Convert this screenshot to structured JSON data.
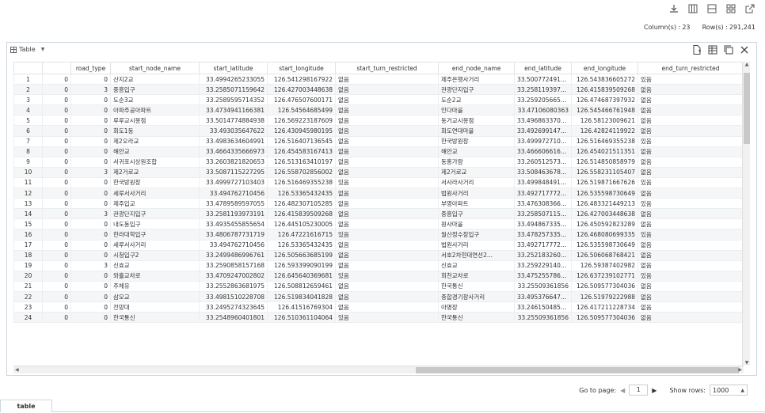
{
  "toolbar": {
    "icons": [
      "download-icon",
      "columns-view-icon",
      "rows-view-icon",
      "grid-view-icon",
      "open-external-icon"
    ]
  },
  "counts": {
    "columns_label": "Column(s) :",
    "columns_value": "23",
    "rows_label": "Row(s) :",
    "rows_value": "291,241"
  },
  "panel": {
    "view_label": "Table",
    "tool_icons": [
      "add-file-icon",
      "table-settings-icon",
      "copy-icon",
      "close-icon"
    ]
  },
  "columns": [
    "",
    "road_type",
    "start_node_name",
    "start_latitude",
    "start_longitude",
    "start_turn_restricted",
    "end_node_name",
    "end_latitude",
    "end_longitude",
    "end_turn_restricted"
  ],
  "rows": [
    [
      "1",
      "0",
      "0",
      "산지2교",
      "33.4994265233055",
      "126.541298167922",
      "없음",
      "제주은행사거리",
      "33.50077249118...",
      "126.543836605272",
      "있음"
    ],
    [
      "2",
      "0",
      "3",
      "중흥입구",
      "33.2585071159642",
      "126.427003448638",
      "없음",
      "관광단지입구",
      "33.25811939731...",
      "126.415839509268",
      "없음"
    ],
    [
      "3",
      "0",
      "0",
      "도순3교",
      "33.2589595714352",
      "126.476507600171",
      "없음",
      "도순2교",
      "33.25920566565...",
      "126.474687397932",
      "없음"
    ],
    [
      "4",
      "0",
      "0",
      "아파주공아파트",
      "33.4734941166381",
      "126.54564685499",
      "없음",
      "인다마을",
      "33.47106080363",
      "126.545466761948",
      "없음"
    ],
    [
      "5",
      "0",
      "0",
      "루루교시몽점",
      "33.5014774884938",
      "126.569223187609",
      "없음",
      "동거교시몽점",
      "33.49686337035...",
      "126.58123009621",
      "없음"
    ],
    [
      "6",
      "0",
      "0",
      "회도1동",
      "33.493035647622",
      "126.430945980195",
      "없음",
      "회도연대마을",
      "33.492699147444",
      "126.42824119922",
      "없음"
    ],
    [
      "7",
      "0",
      "0",
      "제2오라교",
      "33.4983634604991",
      "126.516407136545",
      "없음",
      "한국방원장",
      "33.49997271034...",
      "126.516469355238",
      "있음"
    ],
    [
      "8",
      "0",
      "0",
      "해안교",
      "33.4664335666973",
      "126.454583167413",
      "없음",
      "해안교",
      "33.46660661656...",
      "126.454021511351",
      "없음"
    ],
    [
      "9",
      "0",
      "0",
      "서귀포시상원조합",
      "33.2603821820653",
      "126.513163410197",
      "없음",
      "동홍가람",
      "33.26051257361...",
      "126.514850858979",
      "없음"
    ],
    [
      "10",
      "0",
      "3",
      "제2거로교",
      "33.5087115227295",
      "126.558702856002",
      "없음",
      "제2거로교",
      "33.508463678702",
      "126.558231105407",
      "없음"
    ],
    [
      "11",
      "0",
      "0",
      "한국방원장",
      "33.4999727103403",
      "126.516469355238",
      "있음",
      "서사라사거리",
      "33.4998484915111",
      "126.519871667626",
      "있음"
    ],
    [
      "12",
      "0",
      "0",
      "세루서사거리",
      "33.494762710456",
      "126.53365432435",
      "없음",
      "법원사거리",
      "33.49271777269...",
      "126.535598730649",
      "없음"
    ],
    [
      "13",
      "0",
      "0",
      "제주입교",
      "33.4789589597055",
      "126.482307105285",
      "없음",
      "부영아파트",
      "33.47630836642...",
      "126.483321449213",
      "있음"
    ],
    [
      "14",
      "0",
      "3",
      "관광단지입구",
      "33.2581193973191",
      "126.415839509268",
      "없음",
      "중흥입구",
      "33.25850711596...",
      "126.427003448638",
      "없음"
    ],
    [
      "15",
      "0",
      "0",
      "내도동입구",
      "33.4935455855654",
      "126.445105230005",
      "없음",
      "원사마을",
      "33.49486733576...",
      "126.450592823289",
      "없음"
    ],
    [
      "16",
      "0",
      "0",
      "한라대학입구",
      "33.4806787731719",
      "126.47221616715",
      "있음",
      "월산정수장입구",
      "33.47825733552...",
      "126.468080699335",
      "있음"
    ],
    [
      "17",
      "0",
      "0",
      "세루서사거리",
      "33.494762710456",
      "126.53365432435",
      "없음",
      "법원사거리",
      "33.49271777269...",
      "126.535598730649",
      "없음"
    ],
    [
      "18",
      "0",
      "0",
      "시청입구2",
      "33.2499486996761",
      "126.505663685199",
      "없음",
      "서호2차현대연선2...",
      "33.252183260053",
      "126.506068768421",
      "없음"
    ],
    [
      "19",
      "0",
      "3",
      "신효교",
      "33.2590858157168",
      "126.593399090199",
      "없음",
      "신효교",
      "33.259229140131",
      "126.59387402982",
      "없음"
    ],
    [
      "20",
      "0",
      "0",
      "와흘교차로",
      "33.4709247002802",
      "126.645640369681",
      "있음",
      "회천교차로",
      "33.47525578638...",
      "126.637239102771",
      "있음"
    ],
    [
      "21",
      "0",
      "0",
      "주체유",
      "33.2552863681975",
      "126.508812659461",
      "없음",
      "한국통신",
      "33.25509361856",
      "126.509577304036",
      "없음"
    ],
    [
      "22",
      "0",
      "0",
      "삼모교",
      "33.4981510228708",
      "126.519834041828",
      "없음",
      "종합경기장사거리",
      "33.49537664747...",
      "126.51979222988",
      "없음"
    ],
    [
      "23",
      "0",
      "0",
      "전망대",
      "33.2495274323645",
      "126.41516769304",
      "없음",
      "아명장",
      "33.24615048584...",
      "126.417211228734",
      "없음"
    ],
    [
      "24",
      "0",
      "0",
      "한국통신",
      "33.2548960401801",
      "126.510361104064",
      "있음",
      "한국통신",
      "33.25509361856",
      "126.509577304036",
      "없음"
    ]
  ],
  "pager": {
    "goto_label": "Go to page:",
    "page_value": "1",
    "show_rows_label": "Show rows:",
    "show_rows_value": "1000"
  },
  "bottom_tab": {
    "label": "table"
  }
}
